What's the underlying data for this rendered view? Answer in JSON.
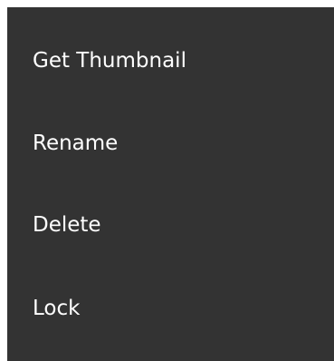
{
  "context_menu": {
    "items": [
      {
        "label": "Get Thumbnail"
      },
      {
        "label": "Rename"
      },
      {
        "label": "Delete"
      },
      {
        "label": "Lock"
      }
    ]
  },
  "colors": {
    "menu_background": "#333333",
    "text": "#ffffff",
    "page_background": "#ffffff"
  }
}
